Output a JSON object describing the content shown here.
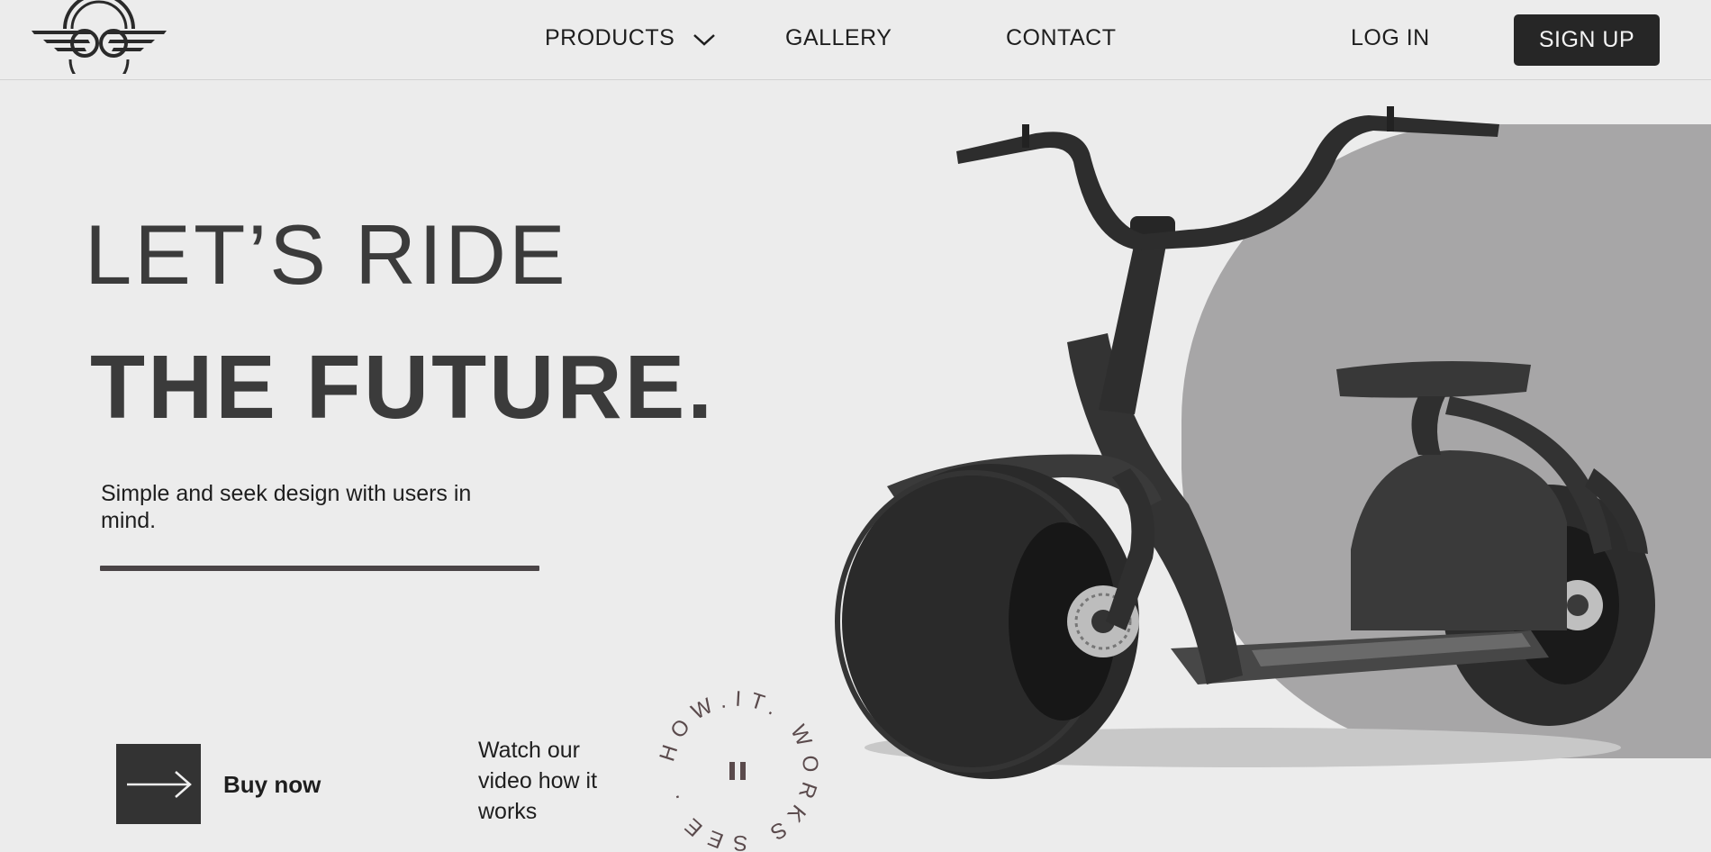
{
  "nav": {
    "items": [
      "PRODUCTS",
      "GALLERY",
      "CONTACT"
    ],
    "login": "LOG IN",
    "signup": "SIGN UP"
  },
  "hero": {
    "line1": "LET’S RIDE",
    "line2": "THE FUTURE.",
    "subtitle": "Simple and seek design with users in mind."
  },
  "cta": {
    "buy_label": "Buy now",
    "watch_text": "Watch our video how it works",
    "badge_text": "HOW.IT. WORKS SEE ."
  },
  "colors": {
    "background": "#ececec",
    "dark": "#262626",
    "accent_shape": "#a7a6a7",
    "badge_text": "#5a4a4c"
  },
  "icons": {
    "logo": "winged-logo-icon",
    "dropdown": "chevron-down-icon",
    "arrow": "arrow-right-icon",
    "pause": "pause-icon"
  }
}
